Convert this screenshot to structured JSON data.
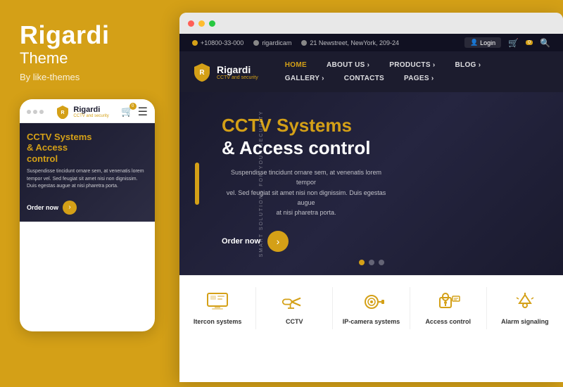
{
  "left": {
    "brand": {
      "title": "Rigardi",
      "subtitle": "Theme",
      "by": "By like-themes"
    },
    "mobile": {
      "logo": "Rigardi",
      "logo_sub": "CCTV and security",
      "cart_count": "0",
      "hero_title_line1": "CCTV Systems",
      "hero_title_line2": "& Access",
      "hero_title_line3": "control",
      "hero_text": "Suspendisse tincidunt ornare sem, at venenatis lorem tempor vel. Sed feugiat sit amet nisi non dignissim. Duis egestas augue at nisi pharetra porta.",
      "order_label": "Order now"
    }
  },
  "browser": {
    "topbar": {
      "phone": "+10800-33-000",
      "email": "rigardicam",
      "address": "21 Newstreet, NewYork, 209-24",
      "login": "Login"
    },
    "nav": {
      "logo": "Rigardi",
      "logo_sub": "CCTV and security",
      "items": [
        {
          "label": "HOME",
          "active": true
        },
        {
          "label": "ABOUT US ›",
          "active": false
        },
        {
          "label": "PRODUCTS ›",
          "active": false
        },
        {
          "label": "BLOG ›",
          "active": false
        },
        {
          "label": "GALLERY ›",
          "active": false
        },
        {
          "label": "CONTACTS",
          "active": false
        },
        {
          "label": "PAGES ›",
          "active": false
        }
      ]
    },
    "hero": {
      "side_text": "SMART SOLUTIONS FOR YOUR SECURITY",
      "title_yellow": "CCTV Systems",
      "title_white": "& Access control",
      "desc_line1": "Suspendisse tincidunt ornare sem, at venenatis lorem tempor",
      "desc_line2": "vel. Sed feugiat sit amet nisi non dignissim. Duis egestas augue",
      "desc_line3": "at nisi pharetra porta.",
      "order_label": "Order now"
    },
    "features": [
      {
        "label": "Itercon systems",
        "icon": "monitor-icon"
      },
      {
        "label": "CCTV",
        "icon": "cctv-icon"
      },
      {
        "label": "IP-camera systems",
        "icon": "ipcam-icon"
      },
      {
        "label": "Access control",
        "icon": "access-icon"
      },
      {
        "label": "Alarm signaling",
        "icon": "alarm-icon"
      }
    ]
  }
}
